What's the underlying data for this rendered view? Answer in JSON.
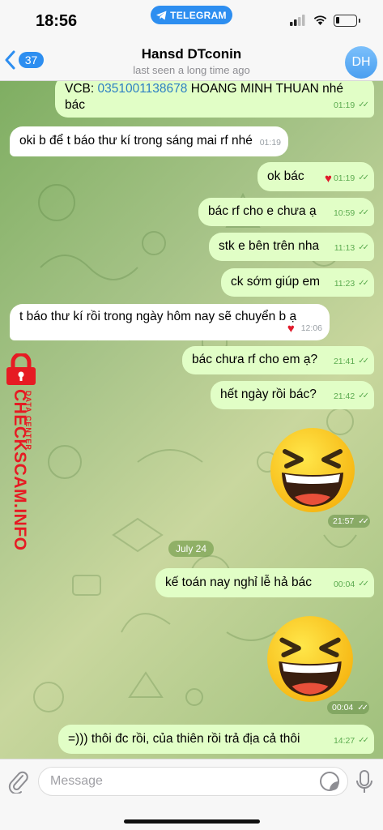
{
  "status_bar": {
    "time": "18:56",
    "app_pill": "TELEGRAM"
  },
  "header": {
    "back_count": "37",
    "title": "Hansd DTconin",
    "subtitle": "last seen a long time ago",
    "avatar_initials": "DH"
  },
  "messages": [
    {
      "side": "out",
      "prefix": "VCB: ",
      "link": "0351001138678",
      "suffix": " HOANG MINH THUAN nhé bác",
      "time": "01:19"
    },
    {
      "side": "in",
      "text": "oki b để t báo thư kí trong sáng mai rf nhé",
      "time": "01:19"
    },
    {
      "side": "out",
      "text": "ok bác",
      "time": "01:19",
      "reaction": "heart"
    },
    {
      "side": "out",
      "text": "bác rf cho e chưa ạ",
      "time": "10:59"
    },
    {
      "side": "out",
      "text": "stk e bên trên nha",
      "time": "11:13"
    },
    {
      "side": "out",
      "text": "ck sớm giúp em",
      "time": "11:23"
    },
    {
      "side": "in",
      "text": "t báo thư kí rồi trong ngày hôm nay sẽ chuyển b ạ",
      "time": "12:06",
      "reaction": "heart"
    },
    {
      "side": "out",
      "text": "bác chưa rf cho em ạ?",
      "time": "21:41"
    },
    {
      "side": "out",
      "text": "hết ngày rồi bác?",
      "time": "21:42"
    },
    {
      "side": "out",
      "type": "sticker",
      "icon": "laughing-emoji",
      "time": "21:57"
    },
    {
      "side": "out",
      "text": "kế toán nay nghỉ lễ hả bác",
      "time": "00:04"
    },
    {
      "side": "out",
      "type": "sticker",
      "icon": "laughing-emoji",
      "time": "00:04"
    },
    {
      "side": "out",
      "text": "=))) thôi đc rồi, của thiên rồi trả địa cả thôi",
      "time": "14:27"
    }
  ],
  "date_separator": "July 24",
  "watermark": {
    "brand": "CHECKSCAM.INFO",
    "tag": "DATA CENTER"
  },
  "composer": {
    "placeholder": "Message"
  },
  "colors": {
    "accent": "#2d8ef0",
    "outgoing_bubble": "#e1fec6",
    "incoming_bubble": "#ffffff",
    "check": "#5bab4f",
    "watermark": "#e61b23"
  }
}
